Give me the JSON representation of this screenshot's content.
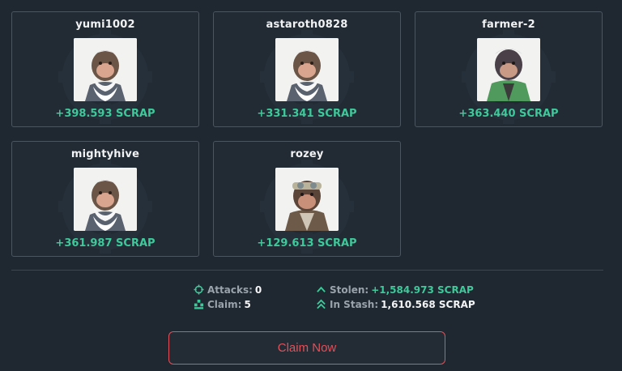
{
  "players": [
    {
      "username": "yumi1002",
      "reward": "+398.593 SCRAP",
      "avatar": "white-bearded-ape-avatar"
    },
    {
      "username": "astaroth0828",
      "reward": "+331.341 SCRAP",
      "avatar": "white-bearded-ape-avatar"
    },
    {
      "username": "farmer-2",
      "reward": "+363.440 SCRAP",
      "avatar": "green-jacket-ape-avatar"
    },
    {
      "username": "mightyhive",
      "reward": "+361.987 SCRAP",
      "avatar": "white-bearded-ape-avatar"
    },
    {
      "username": "rozey",
      "reward": "+129.613 SCRAP",
      "avatar": "goggles-ape-avatar"
    }
  ],
  "stats": {
    "attacks_label": "Attacks:",
    "attacks_value": "0",
    "claim_label": "Claim:",
    "claim_value": "5",
    "stolen_label": "Stolen:",
    "stolen_value": "+1,584.973 SCRAP",
    "stash_label": "In Stash:",
    "stash_value": "1,610.568 SCRAP"
  },
  "actions": {
    "claim_label": "Claim Now"
  },
  "colors": {
    "background": "#1f2730",
    "card_border": "#4a5560",
    "reward_green": "#3ec99a",
    "claim_red": "#e0515a"
  },
  "icons": {
    "attacks": "crosshair-icon",
    "claim": "claim-stack-icon",
    "stolen": "chevron-up-icon",
    "stash": "double-chevron-up-icon"
  }
}
